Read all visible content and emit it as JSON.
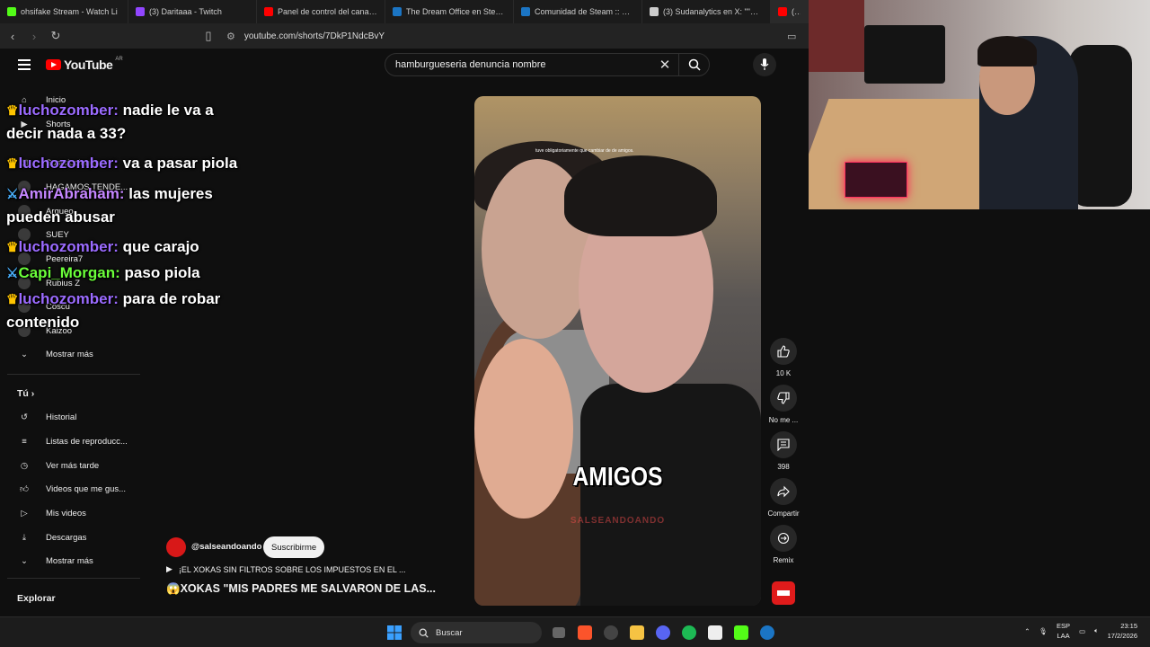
{
  "browser": {
    "tabs": [
      {
        "label": "ohsifake Stream - Watch Li",
        "color": "#53fc18"
      },
      {
        "label": "(3) Daritaaa - Twitch",
        "color": "#9146ff"
      },
      {
        "label": "Panel de control del canal - Yo",
        "color": "#ff0000"
      },
      {
        "label": "The Dream Office en Steam",
        "color": "#1b75c4"
      },
      {
        "label": "Comunidad de Steam :: Guía :",
        "color": "#1b75c4"
      },
      {
        "label": "(3) Sudanalytics en X: \"\"El núm",
        "color": "#cccccc"
      },
      {
        "label": "(1)",
        "color": "#ff0000"
      }
    ],
    "url": "youtube.com/shorts/7DkP1NdcBvY"
  },
  "youtube": {
    "logo": "YouTube",
    "country": "AR",
    "search_query": "hamburgueseria denuncia nombre",
    "sidebar": {
      "main": [
        "Inicio",
        "Shorts",
        "Suscripciones"
      ],
      "subs": [
        "HAGAMOS TENDE...",
        "Arqueo",
        "SUEY",
        "Peereira7",
        "Rubius Z",
        "Coscu",
        "Kaizoo"
      ],
      "more": "Mostrar más",
      "you_header": "Tú",
      "you": [
        "Historial",
        "Listas de reproducc...",
        "Ver más tarde",
        "Videos que me gus...",
        "Mis videos",
        "Descargas",
        "Mostrar más"
      ],
      "explore_header": "Explorar"
    },
    "short": {
      "caption": "tuve obligatoriamente que cambiar de de amigos.",
      "overlay_text": "AMIGOS",
      "watermark": "SALSEANDOANDO",
      "channel": "@salseandoando",
      "subscribe": "Suscribirme",
      "playlist": "¡EL XOKAS SIN FILTROS SOBRE LOS IMPUESTOS EN EL ...",
      "title": "😱XOKAS \"MIS PADRES ME SALVARON DE LAS..."
    },
    "actions": {
      "likes": "10 K",
      "dislike": "No me ...",
      "comments": "398",
      "share": "Compartir",
      "remix": "Remix"
    }
  },
  "chat": [
    {
      "user": "luchozomber:",
      "msg": "nadie le va a decir nada a 33?",
      "badge": "crown"
    },
    {
      "user": "luchozomber:",
      "msg": "va a pasar piola",
      "badge": "crown"
    },
    {
      "user": "AmirAbraham:",
      "msg": "las mujeres pueden abusar",
      "badge": "sword"
    },
    {
      "user": "luchozomber:",
      "msg": "que carajo",
      "badge": "crown"
    },
    {
      "user": "Capi_Morgan:",
      "msg": "paso piola",
      "badge": "sword"
    },
    {
      "user": "luchozomber:",
      "msg": "para de robar contenido",
      "badge": "crown"
    }
  ],
  "taskbar": {
    "search": "Buscar",
    "lang1": "ESP",
    "lang2": "LAA",
    "time": "23:15",
    "date": "17/2/2026"
  }
}
